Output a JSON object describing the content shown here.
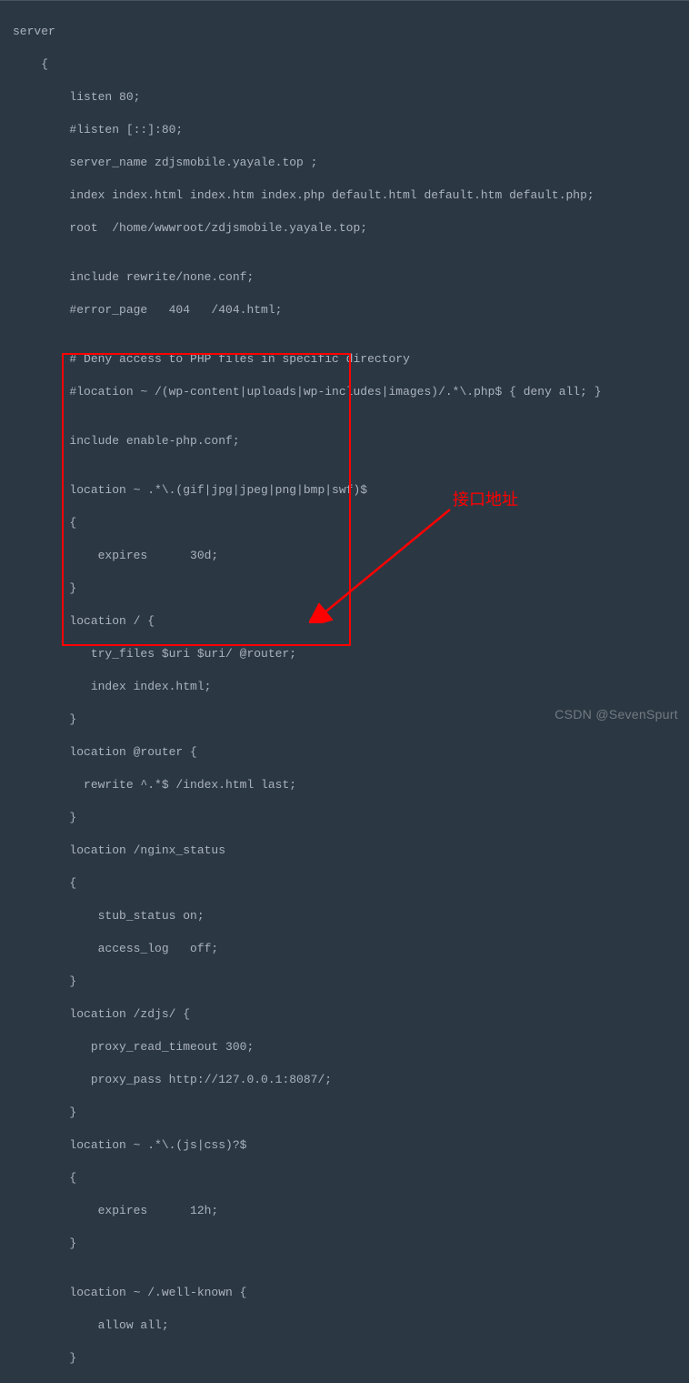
{
  "code": {
    "l1": "server",
    "l2": "    {",
    "l3": "        listen 80;",
    "l4": "        #listen [::]:80;",
    "l5": "        server_name zdjsmobile.yayale.top ;",
    "l6": "        index index.html index.htm index.php default.html default.htm default.php;",
    "l7": "        root  /home/wwwroot/zdjsmobile.yayale.top;",
    "l8": "",
    "l9": "        include rewrite/none.conf;",
    "l10": "        #error_page   404   /404.html;",
    "l11": "",
    "l12": "        # Deny access to PHP files in specific directory",
    "l13": "        #location ~ /(wp-content|uploads|wp-includes|images)/.*\\.php$ { deny all; }",
    "l14": "",
    "l15": "        include enable-php.conf;",
    "l16": "",
    "l17": "        location ~ .*\\.(gif|jpg|jpeg|png|bmp|swf)$",
    "l18": "        {",
    "l19": "            expires      30d;",
    "l20": "        }",
    "l21": "        location / {",
    "l22": "           try_files $uri $uri/ @router;",
    "l23": "           index index.html;",
    "l24": "        }",
    "l25": "        location @router {",
    "l26": "          rewrite ^.*$ /index.html last;",
    "l27": "        }",
    "l28": "        location /nginx_status",
    "l29": "        {",
    "l30": "            stub_status on;",
    "l31": "            access_log   off;",
    "l32": "        }",
    "l33": "        location /zdjs/ {",
    "l34": "           proxy_read_timeout 300;",
    "l35": "           proxy_pass http://127.0.0.1:8087/;",
    "l36": "        }",
    "l37": "        location ~ .*\\.(js|css)?$",
    "l38": "        {",
    "l39": "            expires      12h;",
    "l40": "        }",
    "l41": "",
    "l42": "        location ~ /.well-known {",
    "l43": "            allow all;",
    "l44": "        }"
  },
  "annotation": {
    "label": "接口地址"
  },
  "watermark": "CSDN @SevenSpurt"
}
